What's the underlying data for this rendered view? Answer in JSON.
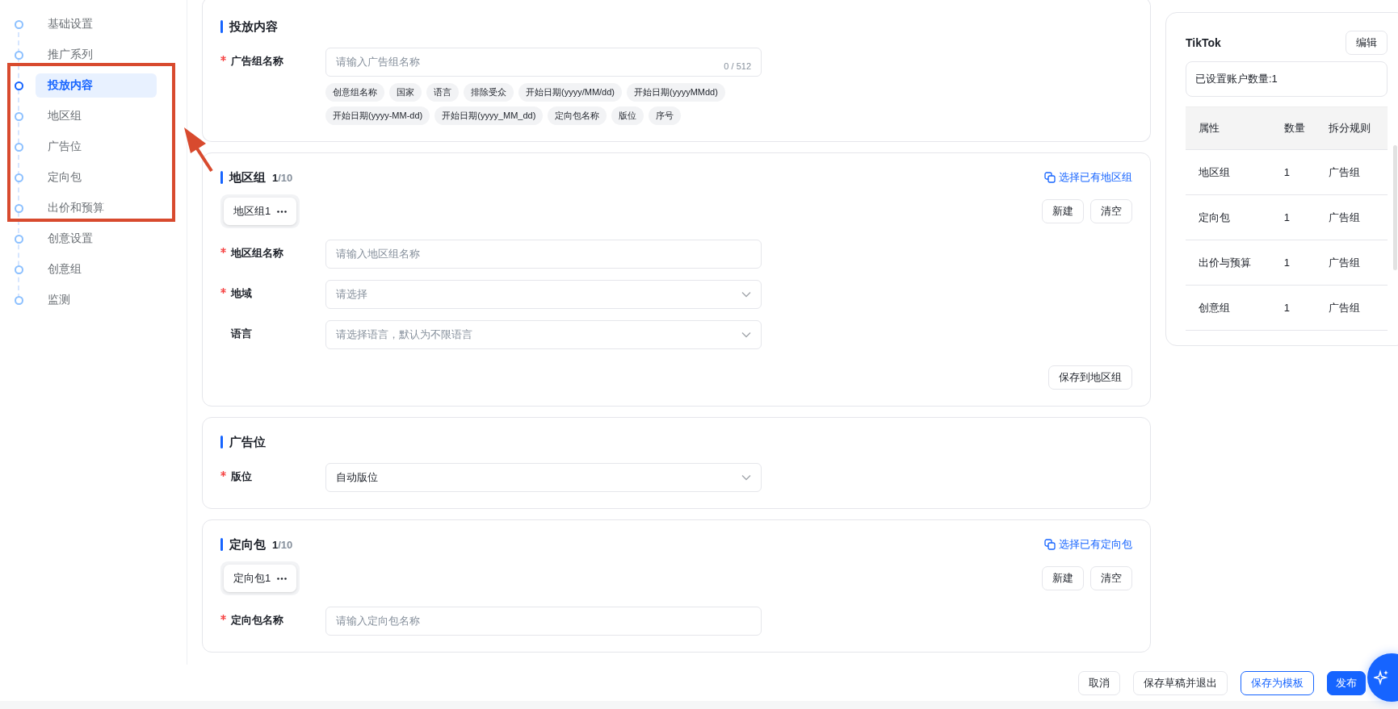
{
  "nav": [
    {
      "label": "基础设置",
      "selected": false
    },
    {
      "label": "推广系列",
      "selected": false
    },
    {
      "label": "投放内容",
      "selected": true
    },
    {
      "label": "地区组",
      "selected": false
    },
    {
      "label": "广告位",
      "selected": false
    },
    {
      "label": "定向包",
      "selected": false
    },
    {
      "label": "出价和预算",
      "selected": false
    },
    {
      "label": "创意设置",
      "selected": false
    },
    {
      "label": "创意组",
      "selected": false
    },
    {
      "label": "监测",
      "selected": false
    }
  ],
  "sections": [
    {
      "title": "投放内容",
      "fields": [
        {
          "label": "广告组名称",
          "required": true,
          "kind": "text",
          "placeholder": "请输入广告组名称",
          "counter": "0 / 512"
        }
      ],
      "tags": [
        "创意组名称",
        "国家",
        "语言",
        "排除受众",
        "开始日期(yyyy/MM/dd)",
        "开始日期(yyyyMMdd)",
        "开始日期(yyyy-MM-dd)",
        "开始日期(yyyy_MM_dd)",
        "定向包名称",
        "版位",
        "序号"
      ]
    },
    {
      "title": "地区组",
      "count": "1",
      "total": "/10",
      "link": "选择已有地区组",
      "chips": [
        "地区组1"
      ],
      "actions": [
        "新建",
        "清空"
      ],
      "fields": [
        {
          "label": "地区组名称",
          "required": true,
          "kind": "text",
          "placeholder": "请输入地区组名称"
        },
        {
          "label": "地域",
          "required": true,
          "kind": "select",
          "placeholder": "请选择"
        },
        {
          "label": "语言",
          "required": false,
          "kind": "select",
          "placeholder": "请选择语言，默认为不限语言"
        }
      ],
      "save": "保存到地区组"
    },
    {
      "title": "广告位",
      "fields": [
        {
          "label": "版位",
          "required": true,
          "kind": "select",
          "value": "自动版位"
        }
      ]
    },
    {
      "title": "定向包",
      "count": "1",
      "total": "/10",
      "link": "选择已有定向包",
      "chips": [
        "定向包1"
      ],
      "actions": [
        "新建",
        "清空"
      ],
      "fields": [
        {
          "label": "定向包名称",
          "required": true,
          "kind": "text",
          "placeholder": "请输入定向包名称"
        }
      ]
    }
  ],
  "summary": {
    "title": "TikTok",
    "edit": "编辑",
    "accounts": "已设置账户数量:1",
    "columns": [
      "属性",
      "数量",
      "拆分规则"
    ],
    "rows": [
      [
        "地区组",
        "1",
        "广告组"
      ],
      [
        "定向包",
        "1",
        "广告组"
      ],
      [
        "出价与预算",
        "1",
        "广告组"
      ],
      [
        "创意组",
        "1",
        "广告组"
      ]
    ]
  },
  "footer": [
    {
      "label": "取消",
      "kind": "default"
    },
    {
      "label": "保存草稿并退出",
      "kind": "default"
    },
    {
      "label": "保存为模板",
      "kind": "outline"
    },
    {
      "label": "发布",
      "kind": "primary"
    }
  ]
}
